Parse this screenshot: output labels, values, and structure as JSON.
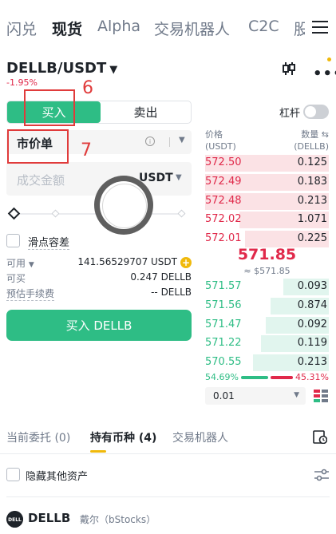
{
  "topnav": {
    "tabs": [
      {
        "label": "闪兑",
        "active": false
      },
      {
        "label": "现货",
        "active": true
      },
      {
        "label": "Alpha",
        "active": false
      },
      {
        "label": "交易机器人",
        "active": false
      },
      {
        "label": "C2C",
        "active": false
      },
      {
        "label": "股",
        "active": false
      }
    ],
    "menu_icon": "hamburger-menu-icon"
  },
  "header": {
    "pair": "DELLB/USDT",
    "change": "-1.95%",
    "chart_icon": "candlestick-chart-icon",
    "more_icon": "more-dots-icon"
  },
  "trade_form": {
    "buy_tab": "买入",
    "sell_tab": "卖出",
    "margin_label": "杠杆",
    "margin_enabled": false,
    "order_type": "市价单",
    "amount_placeholder": "成交金额",
    "amount_unit": "USDT",
    "slippage_label": "滑点容差",
    "available_label": "可用",
    "available_value": "141.56529707 USDT",
    "can_buy_label": "可买",
    "can_buy_value": "0.247 DELLB",
    "fee_label": "预估手续费",
    "fee_value": "-- DELLB",
    "buy_button": "买入 DELLB"
  },
  "order_book": {
    "price_header": "价格",
    "price_unit": "(USDT)",
    "qty_header": "数量",
    "qty_unit": "(DELLB)",
    "asks": [
      {
        "price": "572.50",
        "qty": "0.125",
        "depth": 1.0
      },
      {
        "price": "572.49",
        "qty": "0.183",
        "depth": 1.0
      },
      {
        "price": "572.48",
        "qty": "0.213",
        "depth": 1.0
      },
      {
        "price": "572.02",
        "qty": "1.071",
        "depth": 0.72
      },
      {
        "price": "572.01",
        "qty": "0.225",
        "depth": 0.68
      }
    ],
    "mid_price": "571.85",
    "mid_price_usd": "≈ $571.85",
    "bids": [
      {
        "price": "571.57",
        "qty": "0.093",
        "depth": 0.37
      },
      {
        "price": "571.56",
        "qty": "0.874",
        "depth": 0.47
      },
      {
        "price": "571.47",
        "qty": "0.092",
        "depth": 0.51
      },
      {
        "price": "571.22",
        "qty": "0.119",
        "depth": 0.55
      },
      {
        "price": "570.55",
        "qty": "0.213",
        "depth": 0.61
      }
    ],
    "buy_ratio": "54.69%",
    "sell_ratio": "45.31%",
    "precision": "0.01"
  },
  "bottom_tabs": {
    "tabs": [
      {
        "label": "当前委托 (0)",
        "active": false
      },
      {
        "label": "持有币种 (4)",
        "active": true
      },
      {
        "label": "交易机器人",
        "active": false
      }
    ],
    "hide_other_assets": "隐藏其他资产"
  },
  "assets": [
    {
      "symbol": "DELLB",
      "name": "戴尔（bStocks）",
      "logo_text": "DELL"
    }
  ],
  "annotations": [
    {
      "number": "6"
    },
    {
      "number": "7"
    }
  ],
  "colors": {
    "buy_green": "#2ebd85",
    "sell_red": "#e0294a",
    "accent_yellow": "#f0b90b",
    "annotation_red": "#e03b3b"
  }
}
